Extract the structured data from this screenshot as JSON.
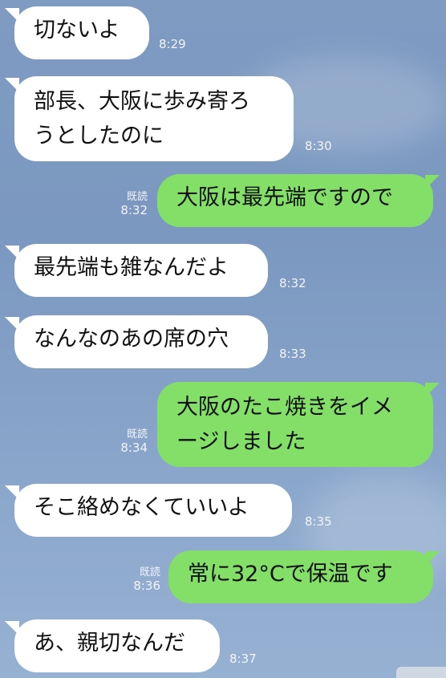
{
  "messages": [
    {
      "side": "in",
      "lines": [
        "切ないよ"
      ],
      "time": "8:29"
    },
    {
      "side": "in",
      "lines": [
        "部長、大阪に歩み寄ろ",
        "うとしたのに"
      ],
      "time": "8:30"
    },
    {
      "side": "out",
      "lines": [
        "大阪は最先端ですので"
      ],
      "time": "8:32",
      "read": "既読"
    },
    {
      "side": "in",
      "lines": [
        "最先端も雑なんだよ"
      ],
      "time": "8:32"
    },
    {
      "side": "in",
      "lines": [
        "なんなのあの席の穴"
      ],
      "time": "8:33"
    },
    {
      "side": "out",
      "lines": [
        "大阪のたこ焼きをイメ",
        "ージしました"
      ],
      "time": "8:34",
      "read": "既読"
    },
    {
      "side": "in",
      "lines": [
        "そこ絡めなくていいよ"
      ],
      "time": "8:35"
    },
    {
      "side": "out",
      "lines": [
        "常に32°Cで保温です"
      ],
      "time": "8:36",
      "read": "既読"
    },
    {
      "side": "in",
      "lines": [
        "あ、親切なんだ"
      ],
      "time": "8:37"
    }
  ],
  "colors": {
    "background": "#7f9bc2",
    "incoming_bubble": "#ffffff",
    "outgoing_bubble": "#84df69",
    "meta_text": "#f2f4f8"
  }
}
